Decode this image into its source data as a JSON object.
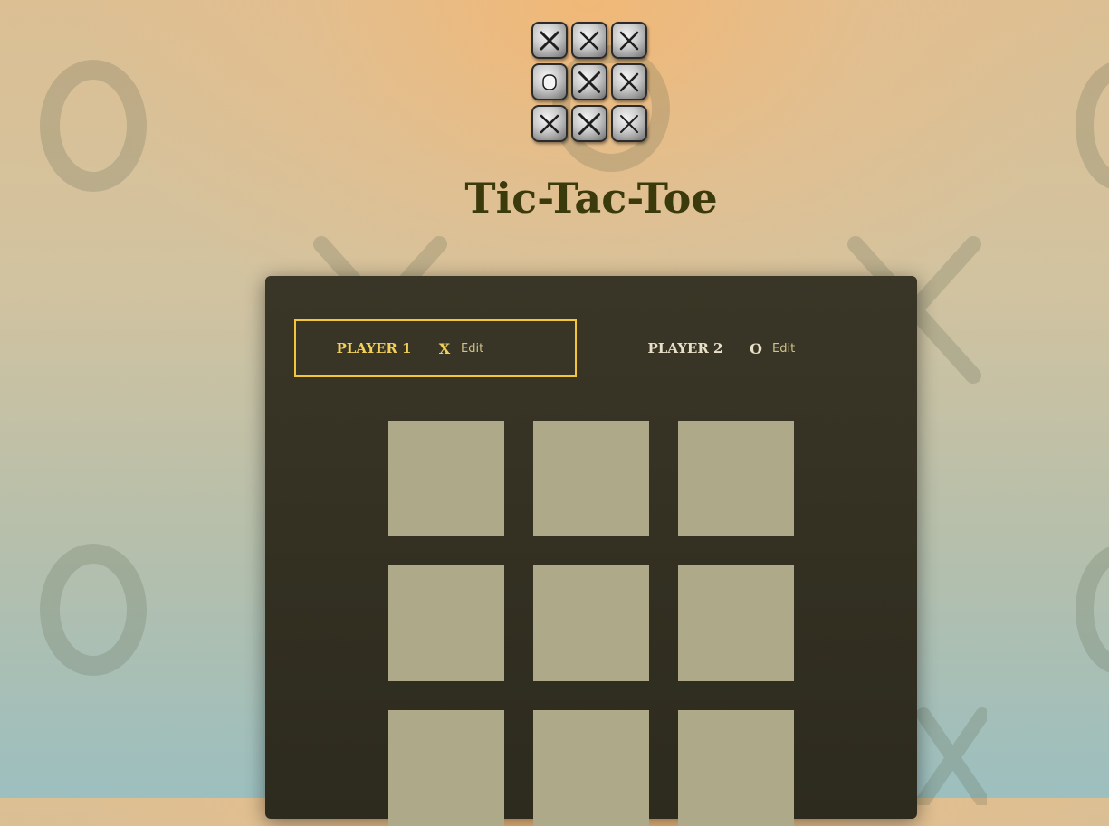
{
  "app": {
    "title": "Tic-Tac-Toe"
  },
  "logo": {
    "tiles": [
      "X",
      "X",
      "X",
      "O",
      "X",
      "X",
      "X",
      "X",
      "X"
    ]
  },
  "players": [
    {
      "label": "PLAYER 1",
      "symbol": "X",
      "edit_label": "Edit",
      "active": true
    },
    {
      "label": "PLAYER 2",
      "symbol": "O",
      "edit_label": "Edit",
      "active": false
    }
  ],
  "board": {
    "cells": [
      "",
      "",
      "",
      "",
      "",
      "",
      "",
      "",
      ""
    ]
  },
  "colors": {
    "accent": "#f2c638",
    "panel": "#353223",
    "cell": "#aeaa89",
    "title": "#3b3a0c"
  },
  "background_marks": [
    "O",
    "X",
    "O",
    "X",
    "O",
    "X",
    "O",
    "X"
  ]
}
